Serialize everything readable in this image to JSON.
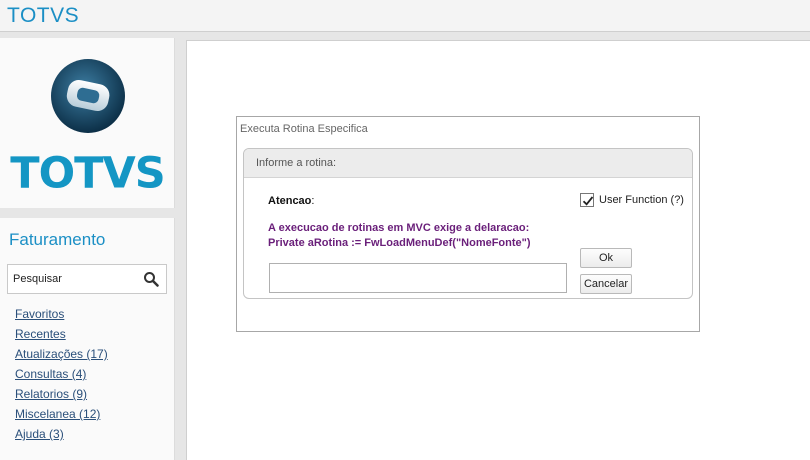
{
  "app": {
    "brand": "TOTVS"
  },
  "logo": {
    "wordmark": "TOTVS",
    "icon": "totvs-logo-icon",
    "color": "#1496c4"
  },
  "sidebar": {
    "module_title": "Faturamento",
    "search": {
      "placeholder": "Pesquisar",
      "icon": "search-icon"
    },
    "items": [
      {
        "label": "Favoritos"
      },
      {
        "label": "Recentes"
      },
      {
        "label": "Atualizações (17)"
      },
      {
        "label": "Consultas (4)"
      },
      {
        "label": "Relatorios (9)"
      },
      {
        "label": "Miscelanea (12)"
      },
      {
        "label": "Ajuda (3)"
      }
    ]
  },
  "dialog": {
    "title": "Executa Rotina Especifica",
    "group_label": "Informe a rotina:",
    "attention_label": "Atencao",
    "attention_colon": ":",
    "message_line1": "A execucao de rotinas em MVC exige a delaracao:",
    "message_line2": "Private aRotina := FwLoadMenuDef(\"NomeFonte\")",
    "user_function": {
      "label": "User Function (?)",
      "checked": true
    },
    "routine_input": {
      "value": ""
    },
    "ok_label": "Ok",
    "cancel_label": "Cancelar"
  },
  "colors": {
    "brand": "#1b8fc5",
    "message": "#6a1f7a",
    "link": "#2a4f7a"
  }
}
